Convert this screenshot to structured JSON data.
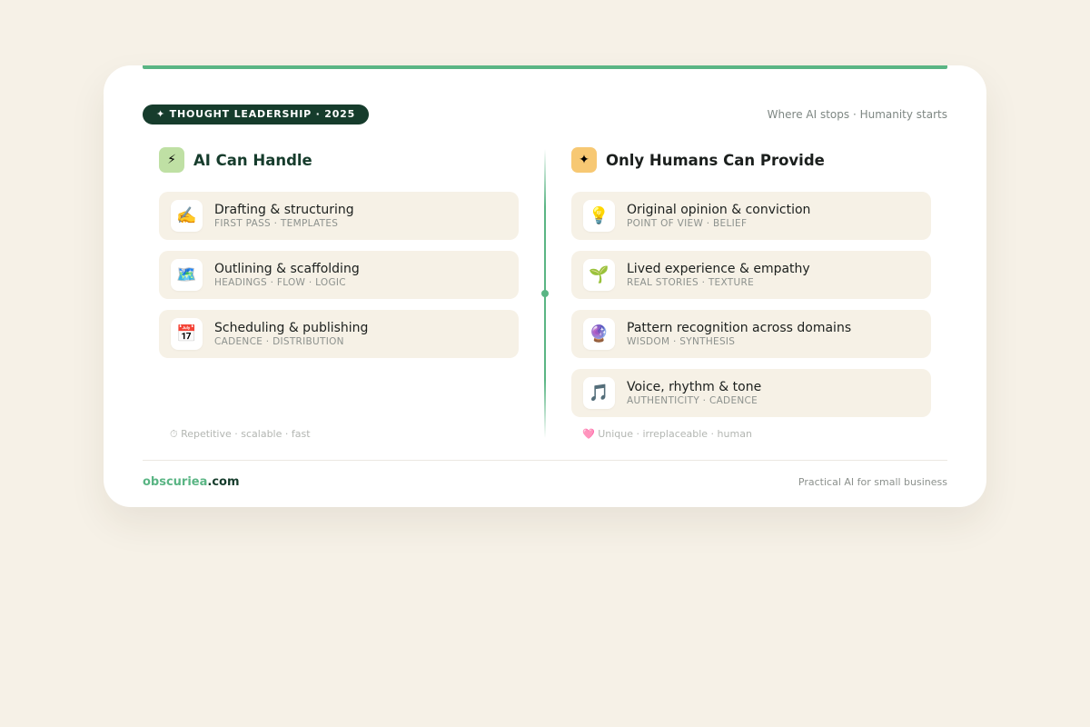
{
  "badge": "✦ THOUGHT LEADERSHIP · 2025",
  "tagline": "Where AI stops · Humanity starts",
  "left": {
    "icon": "⚡",
    "icon_name": "lightning-icon",
    "title": "AI Can Handle",
    "items": [
      {
        "icon": "✍️",
        "title": "Drafting & structuring",
        "sub": "FIRST PASS · TEMPLATES"
      },
      {
        "icon": "🗺️",
        "title": "Outlining & scaffolding",
        "sub": "HEADINGS · FLOW · LOGIC"
      },
      {
        "icon": "📅",
        "title": "Scheduling & publishing",
        "sub": "CADENCE · DISTRIBUTION"
      }
    ],
    "note": "⏱ Repetitive · scalable · fast"
  },
  "right": {
    "icon": "✦",
    "icon_name": "sparkle-icon",
    "title": "Only Humans Can Provide",
    "items": [
      {
        "icon": "💡",
        "title": "Original opinion & conviction",
        "sub": "POINT OF VIEW · BELIEF"
      },
      {
        "icon": "🌱",
        "title": "Lived experience & empathy",
        "sub": "REAL STORIES · TEXTURE"
      },
      {
        "icon": "🔮",
        "title": "Pattern recognition across domains",
        "sub": "WISDOM · SYNTHESIS"
      },
      {
        "icon": "🎵",
        "title": "Voice, rhythm & tone",
        "sub": "AUTHENTICITY · CADENCE"
      }
    ],
    "note": "🩷 Unique · irreplaceable · human"
  },
  "footer": {
    "brand_a": "obscuriea",
    "brand_b": ".com",
    "right": "Practical AI for small business"
  },
  "colors": {
    "accent": "#5ab584",
    "dark": "#163c2c",
    "background": "#f6f1e7",
    "left_icon_bg": "#bfe0a4",
    "right_icon_bg": "#f7c873"
  }
}
